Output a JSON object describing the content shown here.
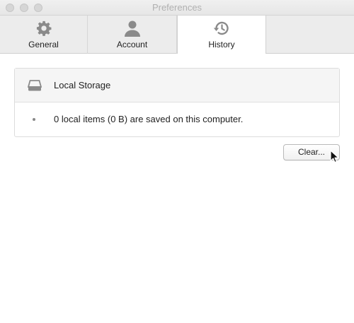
{
  "window": {
    "title": "Preferences"
  },
  "tabs": [
    {
      "label": "General",
      "icon": "gear-icon"
    },
    {
      "label": "Account",
      "icon": "person-icon"
    },
    {
      "label": "History",
      "icon": "history-icon",
      "selected": true
    }
  ],
  "storage": {
    "title": "Local Storage",
    "icon": "drive-icon",
    "summary": "0 local items (0 B) are saved on this computer."
  },
  "actions": {
    "clear_label": "Clear..."
  },
  "colors": {
    "icon_gray": "#8a8a8a",
    "selected_tab_bg": "#ffffff",
    "toolbar_bg": "#ececec"
  }
}
